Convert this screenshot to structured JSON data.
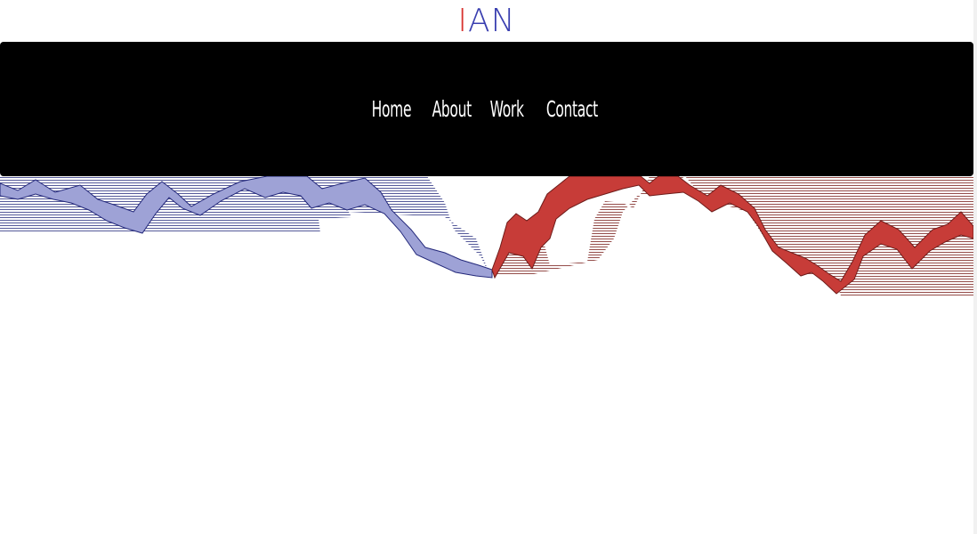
{
  "logo": {
    "part1": "I",
    "part2": "AN"
  },
  "nav": {
    "items": [
      "Home",
      "About",
      "Work",
      "Contact"
    ]
  },
  "colors": {
    "logo_i": "#d8332f",
    "logo_an": "#3a3fb0",
    "navbar_bg": "#000000",
    "nav_text": "#ffffff",
    "ribbon_blue": "#9ea2d6",
    "ribbon_blue_line": "#23287a",
    "ribbon_red": "#c73c38",
    "ribbon_red_line": "#6e1c1a"
  }
}
